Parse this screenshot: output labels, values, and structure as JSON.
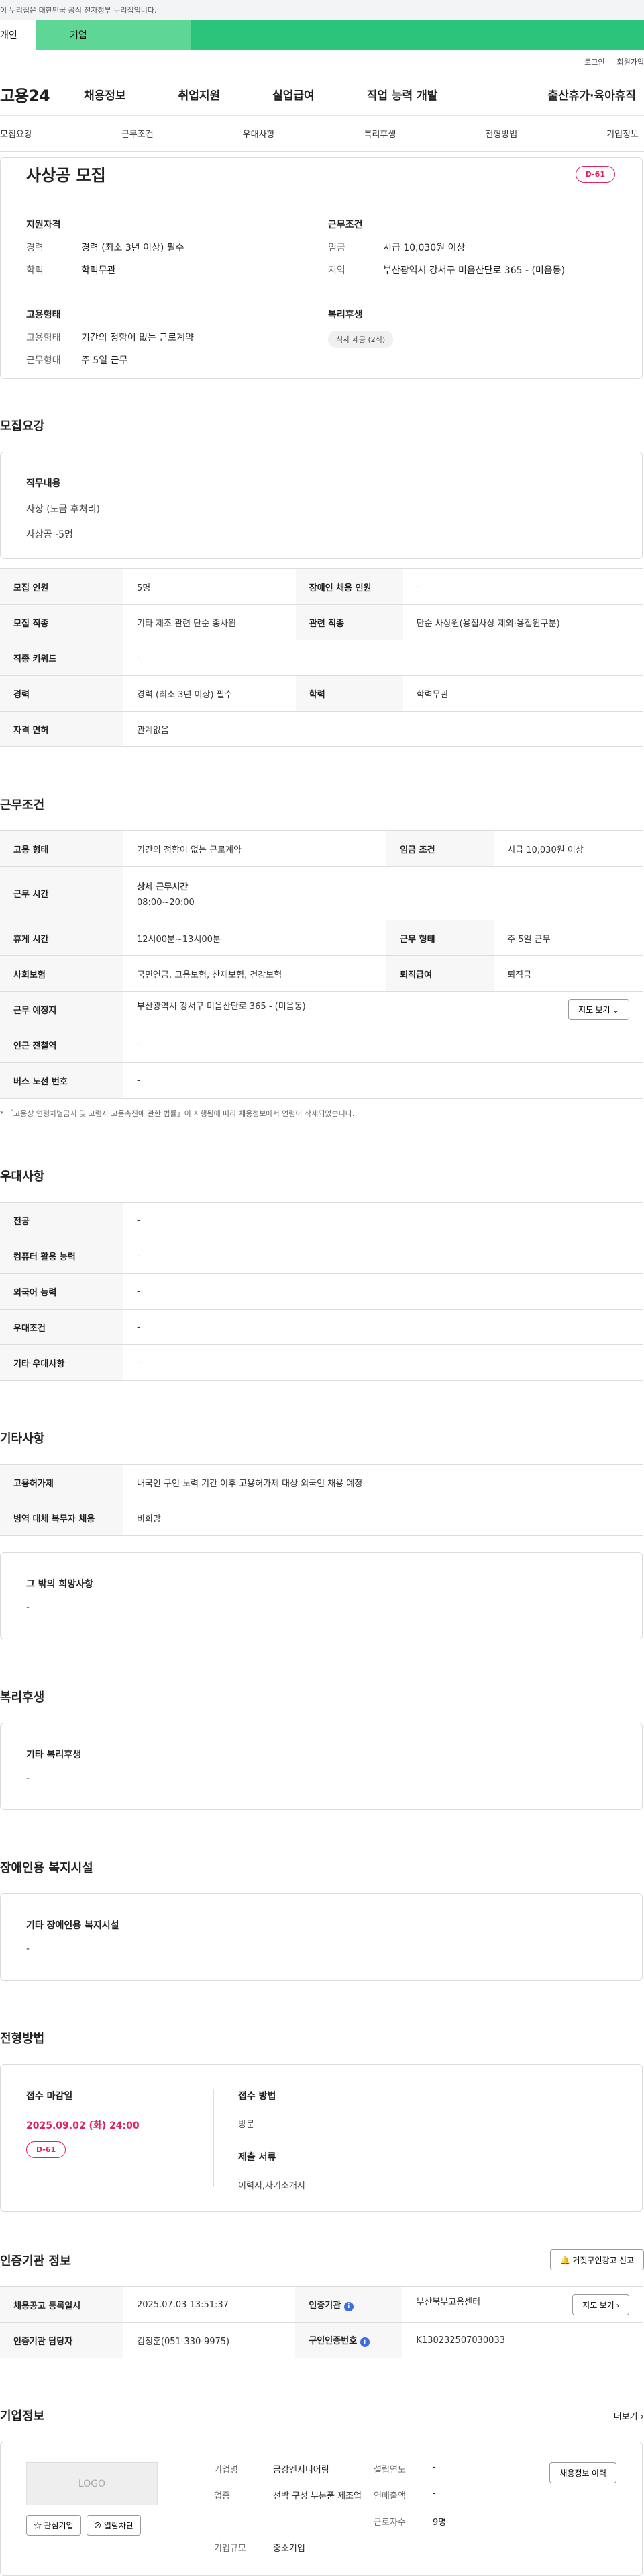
{
  "gov_bar": "이 누리집은 대한민국 공식 전자정부 누리집입니다.",
  "user_tabs": [
    "개인",
    "기업"
  ],
  "util": [
    "로그인",
    "회원가입"
  ],
  "logo": "고용24",
  "gnb": [
    "채용정보",
    "취업지원",
    "실업급여",
    "직업 능력 개발",
    "출산휴가·육아휴직"
  ],
  "subtabs": [
    "모집요강",
    "근무조건",
    "우대사항",
    "복리후생",
    "전형방법",
    "기업정보"
  ],
  "head": {
    "title": "사상공 모집",
    "dday": "D-61",
    "qual": {
      "title": "지원자격",
      "rows": [
        {
          "k": "경력",
          "v": "경력 (최소 3년 이상) 필수"
        },
        {
          "k": "학력",
          "v": "학력무관"
        }
      ]
    },
    "cond": {
      "title": "근무조건",
      "rows": [
        {
          "k": "임금",
          "v": "시급 10,030원 이상"
        },
        {
          "k": "지역",
          "v": "부산광역시 강서구 미음산단로 365 - (미음동)"
        }
      ]
    },
    "emp": {
      "title": "고용형태",
      "rows": [
        {
          "k": "고용형태",
          "v": "기간의 정함이 없는 근로계약"
        },
        {
          "k": "근무형태",
          "v": "주 5일 근무"
        }
      ]
    },
    "welfare": {
      "title": "복리후생",
      "badge": "식사 제공 (2식)"
    }
  },
  "recruit": {
    "title": "모집요강",
    "job_label": "직무내용",
    "job_lines": [
      "사상 (도금 후처리)",
      "사상공 -5명"
    ],
    "table": [
      [
        {
          "k": "모집 인원",
          "v": "5명"
        },
        {
          "k": "장애인 채용 인원",
          "v": "-"
        }
      ],
      [
        {
          "k": "모집 직종",
          "v": "기타 제조 관련 단순 종사원"
        },
        {
          "k": "관련 직종",
          "v": "단순 사상원(용접사상 제외·용접원구분)"
        }
      ],
      [
        {
          "k": "직종 키워드",
          "v": "-"
        }
      ],
      [
        {
          "k": "경력",
          "v": "경력 (최소 3년 이상) 필수"
        },
        {
          "k": "학력",
          "v": "학력무관"
        }
      ],
      [
        {
          "k": "자격 면허",
          "v": "관계없음"
        }
      ]
    ]
  },
  "work": {
    "title": "근무조건",
    "emp_type": {
      "k": "고용 형태",
      "v": "기간의 정함이 없는 근로계약"
    },
    "wage": {
      "k": "임금 조건",
      "v": "시급 10,030원 이상"
    },
    "hours": {
      "k": "근무 시간",
      "v1": "상세 근무시간",
      "v2": "08:00~20:00"
    },
    "rest": {
      "k": "휴게 시간",
      "v": "12시00분~13시00분"
    },
    "work_form": {
      "k": "근무 형태",
      "v": "주 5일 근무"
    },
    "insurance": {
      "k": "사회보험",
      "v": "국민연금, 고용보험, 산재보험, 건강보험"
    },
    "severance": {
      "k": "퇴직급여",
      "v": "퇴직금"
    },
    "location": {
      "k": "근무 예정지",
      "v": "부산광역시 강서구 미음산단로 365 - (미음동)"
    },
    "map_btn": "지도 보기",
    "station": {
      "k": "인근 전철역",
      "v": "-"
    },
    "bus": {
      "k": "버스 노선 번호",
      "v": "-"
    },
    "note": "* 「고용상 연령차별금지 및 고령자 고용촉진에 관한 법률」이 시행됨에 따라 채용정보에서 연령이 삭제되었습니다."
  },
  "prefer": {
    "title": "우대사항",
    "rows": [
      {
        "k": "전공",
        "v": "-"
      },
      {
        "k": "컴퓨터 활용 능력",
        "v": "-"
      },
      {
        "k": "외국어 능력",
        "v": "-"
      },
      {
        "k": "우대조건",
        "v": "-"
      },
      {
        "k": "기타 우대사항",
        "v": "-"
      }
    ]
  },
  "etc": {
    "title": "기타사항",
    "rows": [
      {
        "k": "고용허가제",
        "v": "내국인 구인 노력 기간 이후 고용허가제 대상 외국인 채용 예정"
      },
      {
        "k": "병역 대체 복무자 채용",
        "v": "비희망"
      }
    ],
    "other_label": "그 밖의 희망사항",
    "other_value": "-"
  },
  "benefit": {
    "title": "복리후생",
    "label": "기타 복리후생",
    "value": "-"
  },
  "disabled": {
    "title": "장애인용 복지시설",
    "label": "기타 장애인용 복지시설",
    "value": "-"
  },
  "screening": {
    "title": "전형방법",
    "deadline_label": "접수 마감일",
    "deadline": "2025.09.02 (화) 24:00",
    "dday": "D-61",
    "method_label": "접수 방법",
    "method": "방문",
    "docs_label": "제출 서류",
    "docs": "이력서,자기소개서"
  },
  "cert": {
    "title": "인증기관 정보",
    "report_btn": "거짓구인광고 신고",
    "reg_date": {
      "k": "채용공고 등록일시",
      "v": "2025.07.03 13:51:37"
    },
    "agency": {
      "k": "인증기관",
      "v": "부산북부고용센터"
    },
    "map_btn": "지도 보기",
    "manager": {
      "k": "인증기관 담당자",
      "v": "김정훈(051-330-9975)"
    },
    "cert_no": {
      "k": "구인인증번호",
      "v": "K130232507030033"
    }
  },
  "corp": {
    "title": "기업정보",
    "more": "더보기",
    "logo": "LOGO",
    "fav_btn": "관심기업",
    "block_btn": "열람차단",
    "history_btn": "채용정보 이력",
    "info": [
      {
        "k": "기업명",
        "v": "금강엔지니어링"
      },
      {
        "k": "설립연도",
        "v": "-"
      },
      {
        "k": "업종",
        "v": "선박 구성 부분품 제조업"
      },
      {
        "k": "연매출액",
        "v": "-"
      },
      {
        "k": "",
        "v": ""
      },
      {
        "k": "근로자수",
        "v": "9명"
      },
      {
        "k": "기업규모",
        "v": "중소기업"
      }
    ]
  },
  "colors": {
    "accent": "#2bc47a",
    "dday": "#e0245e",
    "info_icon": "#3b6fe0"
  }
}
